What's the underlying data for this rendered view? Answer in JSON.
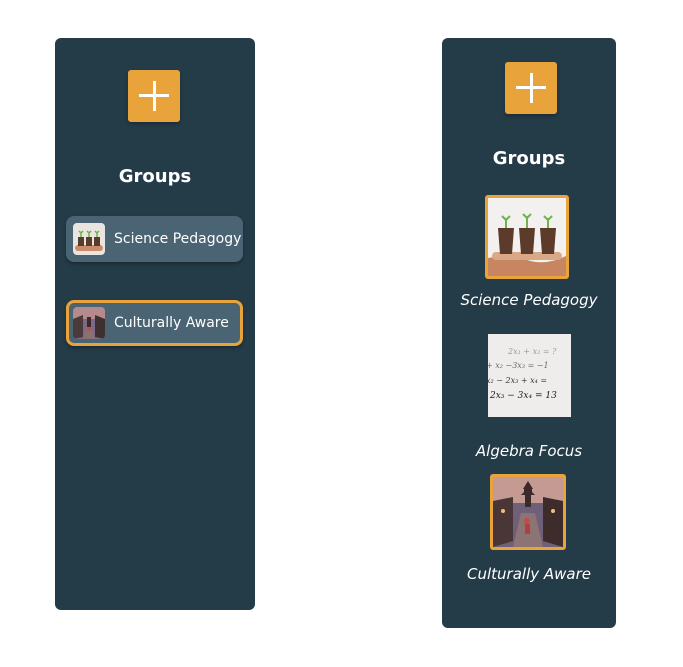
{
  "left_panel": {
    "heading": "Groups",
    "add_icon": "plus-icon",
    "items": [
      {
        "label": "Science Pedagogy",
        "selected": false
      },
      {
        "label": "Culturally Aware",
        "selected": true
      }
    ]
  },
  "right_panel": {
    "heading": "Groups",
    "add_icon": "plus-icon",
    "items": [
      {
        "label": "Science Pedagogy",
        "selected": true
      },
      {
        "label": "Algebra Focus",
        "selected": false
      },
      {
        "label": "Culturally Aware",
        "selected": true
      }
    ]
  },
  "colors": {
    "panel": "#243b48",
    "accent": "#e8a33a",
    "pill": "#4a6474"
  }
}
